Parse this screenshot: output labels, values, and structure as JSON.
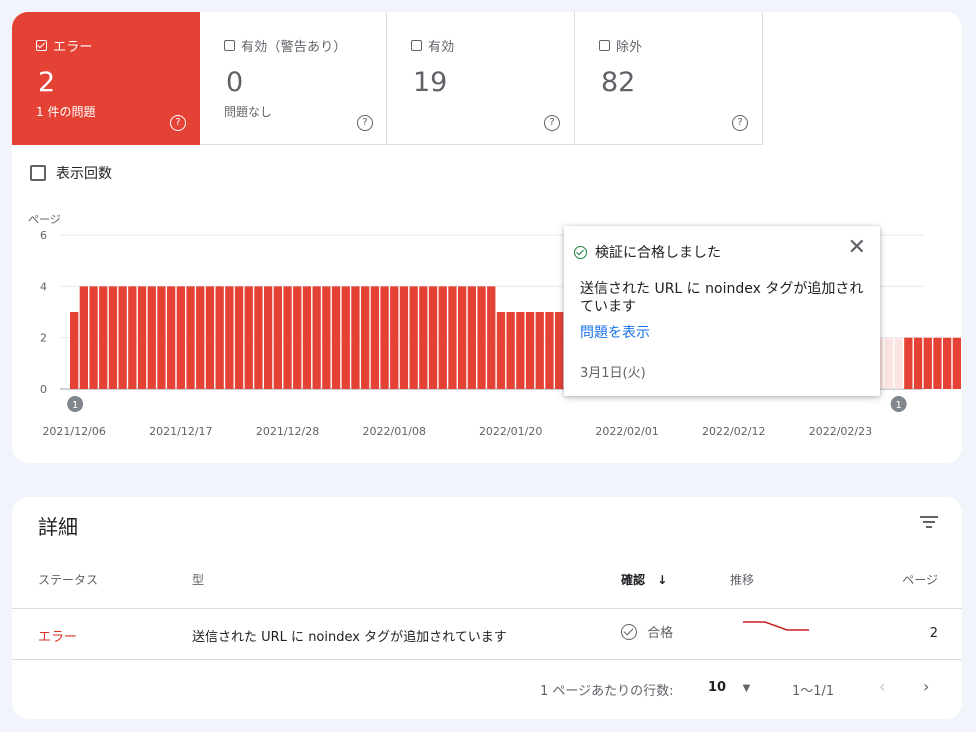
{
  "tiles": [
    {
      "label": "エラー",
      "count": "2",
      "sub": "1 件の問題",
      "checked": true
    },
    {
      "label": "有効（警告あり）",
      "count": "0",
      "sub": "問題なし",
      "checked": false
    },
    {
      "label": "有効",
      "count": "19",
      "sub": "",
      "checked": false
    },
    {
      "label": "除外",
      "count": "82",
      "sub": "",
      "checked": false
    }
  ],
  "help_glyph": "?",
  "impressions_label": "表示回数",
  "colors": {
    "error": "#e54236",
    "error_light": "#fbe3e1",
    "link": "#1a73e8",
    "pass": "#188038"
  },
  "chart_data": {
    "type": "bar",
    "ylabel": "ページ",
    "ylim": [
      0,
      6
    ],
    "yticks": [
      0,
      2,
      4,
      6
    ],
    "x_tick_labels": [
      "2021/12/06",
      "2021/12/17",
      "2021/12/28",
      "2022/01/08",
      "2022/01/20",
      "2022/02/01",
      "2022/02/12",
      "2022/02/23"
    ],
    "start_date": "2021/12/06",
    "series": [
      {
        "values": [
          3,
          4,
          4,
          4,
          4,
          4,
          4,
          4,
          4,
          4,
          4,
          4,
          4,
          4,
          4,
          4,
          4,
          4,
          4,
          4,
          4,
          4,
          4,
          4,
          4,
          4,
          4,
          4,
          4,
          4,
          4,
          4,
          4,
          4,
          4,
          4,
          4,
          4,
          4,
          4,
          4,
          4,
          4,
          4,
          3,
          3,
          3,
          3,
          3,
          3,
          3,
          3,
          3,
          3,
          3,
          3,
          3,
          3,
          3,
          3,
          3,
          3,
          3,
          3,
          3,
          3,
          2,
          2,
          2,
          2,
          2,
          2,
          2,
          2,
          2,
          2,
          2,
          2,
          2,
          2,
          2,
          2,
          2,
          2,
          2,
          2,
          2,
          2,
          2,
          2,
          2,
          2,
          2
        ]
      }
    ],
    "highlight_range": [
      "2022/02/01",
      "2022/03/01"
    ],
    "annotations": [
      {
        "date": "2021/12/06",
        "label": "1"
      },
      {
        "date": "2022/03/01",
        "label": "1"
      }
    ],
    "grid": true
  },
  "tooltip": {
    "title": "検証に合格しました",
    "description": "送信された URL に noindex タグが追加されています",
    "link": "問題を表示",
    "date": "3月1日(火)"
  },
  "details": {
    "title": "詳細",
    "columns": {
      "status": "ステータス",
      "type": "型",
      "validation": "確認",
      "sort_arrow": "↓",
      "trend": "推移",
      "pages": "ページ"
    },
    "rows": [
      {
        "status": "エラー",
        "type": "送信された URL に noindex タグが追加されています",
        "validation": "合格",
        "trend": [
          3,
          3,
          2,
          2
        ],
        "pages": "2"
      }
    ],
    "pagination": {
      "rows_per_page_label": "1 ページあたりの行数:",
      "rows_per_page": "10",
      "range": "1〜1/1"
    }
  }
}
